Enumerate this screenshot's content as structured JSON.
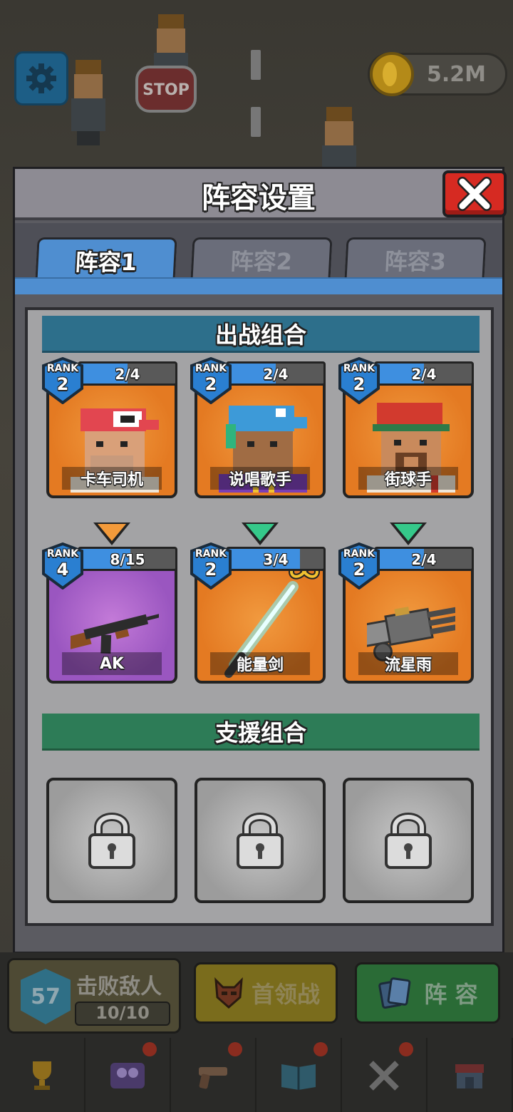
{
  "hud_top": {
    "coins": "5.2M",
    "stop_sign": "STOP"
  },
  "modal": {
    "title": "阵容设置",
    "tabs": [
      {
        "label": "阵容1",
        "active": true
      },
      {
        "label": "阵容2",
        "active": false
      },
      {
        "label": "阵容3",
        "active": false
      }
    ],
    "battle_section_title": "出战组合",
    "support_section_title": "支援组合",
    "heroes": [
      {
        "rank_label": "RANK",
        "rank": "2",
        "progress": "2/4",
        "progress_fraction": 0.5,
        "name": "卡车司机",
        "card_color": "orange",
        "hat_color": "#e24650",
        "shirt_color": "#efe6d8"
      },
      {
        "rank_label": "RANK",
        "rank": "2",
        "progress": "2/4",
        "progress_fraction": 0.5,
        "name": "说唱歌手",
        "card_color": "orange",
        "hat_color": "#3d9ad8",
        "shirt_color": "#7c3fb5"
      },
      {
        "rank_label": "RANK",
        "rank": "2",
        "progress": "2/4",
        "progress_fraction": 0.5,
        "name": "街球手",
        "card_color": "orange",
        "hat_color": "#d23a2e",
        "shirt_color": "#efe6d8"
      }
    ],
    "arrows": [
      "orange",
      "green",
      "green"
    ],
    "weapons": [
      {
        "rank_label": "RANK",
        "rank": "4",
        "progress": "8/15",
        "progress_fraction": 0.53,
        "name": "AK",
        "card_color": "purple",
        "icon": "rifle-icon"
      },
      {
        "rank_label": "RANK",
        "rank": "2",
        "progress": "3/4",
        "progress_fraction": 0.75,
        "name": "能量剑",
        "card_color": "orange",
        "icon": "lightsaber-icon"
      },
      {
        "rank_label": "RANK",
        "rank": "2",
        "progress": "2/4",
        "progress_fraction": 0.5,
        "name": "流星雨",
        "card_color": "orange",
        "icon": "minigun-icon"
      }
    ],
    "support_slots": [
      "locked",
      "locked",
      "locked"
    ]
  },
  "hud_bottom": {
    "level": "57",
    "defeat_label": "击败敌人",
    "defeat_count": "10/10",
    "boss_label": "首领战",
    "lineup_label": "阵 容",
    "nav_items": [
      "trophy-icon",
      "team-icon",
      "pistol-icon",
      "book-icon",
      "swords-icon",
      "shop-icon"
    ]
  },
  "colors": {
    "accent_blue": "#4f8ed0",
    "close_red": "#d62a22",
    "battle_header": "#2d6f8b",
    "support_header": "#2d7c57"
  }
}
